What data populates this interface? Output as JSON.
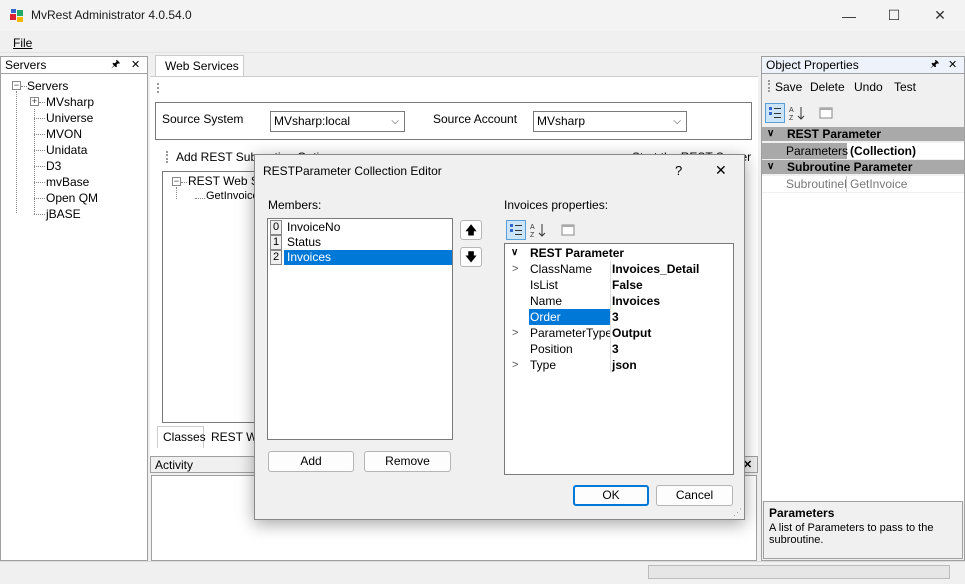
{
  "window": {
    "title": "MvRest Administrator 4.0.54.0",
    "minimize": "—",
    "maximize": "☐",
    "close": "✕"
  },
  "menu": {
    "file": "File"
  },
  "servers_panel": {
    "header": "Servers",
    "pin": "🖈",
    "close": "✕",
    "root": "Servers",
    "items": [
      "MVsharp",
      "Universe",
      "MVON",
      "Unidata",
      "D3",
      "mvBase",
      "Open QM",
      "jBASE"
    ]
  },
  "main": {
    "tab": "Web Services",
    "source_system_label": "Source System",
    "source_system_value": "MVsharp:local",
    "source_account_label": "Source Account",
    "source_account_value": "MVsharp",
    "add_rest_label": "Add REST Subroutine Options",
    "start_label": "Start the REST Server",
    "tree_root": "REST Web Se",
    "tree_child": "GetInvoice",
    "bottom_tab_classes": "Classes",
    "bottom_tab_rest": "REST W",
    "activity_header": "Activity"
  },
  "dialog": {
    "title": "RESTParameter Collection Editor",
    "help": "?",
    "close": "✕",
    "members_label": "Members:",
    "members": [
      {
        "index": "0",
        "name": "InvoiceNo"
      },
      {
        "index": "1",
        "name": "Status"
      },
      {
        "index": "2",
        "name": "Invoices"
      }
    ],
    "up_icon": "🡅",
    "down_icon": "🡇",
    "add_button": "Add",
    "remove_button": "Remove",
    "properties_label": "Invoices properties:",
    "category": "REST Parameter",
    "properties": [
      {
        "name": "ClassName",
        "value": "Invoices_Detail",
        "expandable": true
      },
      {
        "name": "IsList",
        "value": "False",
        "expandable": false
      },
      {
        "name": "Name",
        "value": "Invoices",
        "expandable": false
      },
      {
        "name": "Order",
        "value": "3",
        "expandable": false,
        "selected": true
      },
      {
        "name": "ParameterType",
        "value": "Output",
        "expandable": true
      },
      {
        "name": "Position",
        "value": "3",
        "expandable": false
      },
      {
        "name": "Type",
        "value": "json",
        "expandable": true
      }
    ],
    "ok_button": "OK",
    "cancel_button": "Cancel"
  },
  "object_properties": {
    "header": "Object Properties",
    "pin": "🖈",
    "close": "✕",
    "toolbar": [
      "Save",
      "Delete",
      "Undo",
      "Test"
    ],
    "category1": "REST Parameter",
    "param_name": "Parameters",
    "param_value": "(Collection)",
    "category2": "Subroutine Parameter",
    "sub_name": "SubroutineN",
    "sub_value": "GetInvoice",
    "help_title": "Parameters",
    "help_text": "A list of Parameters to pass to the subroutine."
  },
  "colors": {
    "selection": "#0078d7",
    "category_bg": "#a9a9a9",
    "accent_border": "#0078d7"
  }
}
